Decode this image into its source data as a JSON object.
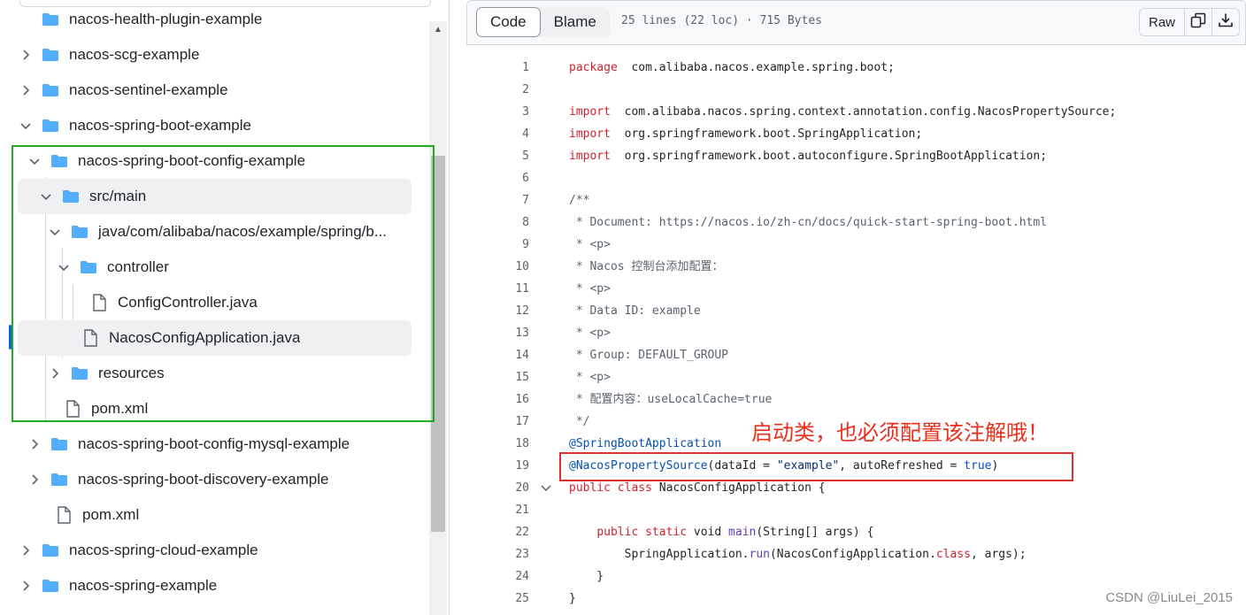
{
  "tree": {
    "rows": [
      {
        "label": "nacos-health-plugin-example",
        "type": "folder",
        "expanded": false
      },
      {
        "label": "nacos-scg-example",
        "type": "folder",
        "expanded": false
      },
      {
        "label": "nacos-sentinel-example",
        "type": "folder",
        "expanded": false
      },
      {
        "label": "nacos-spring-boot-example",
        "type": "folder",
        "expanded": true
      },
      {
        "label": "nacos-spring-boot-config-example",
        "type": "folder",
        "expanded": true
      },
      {
        "label": "src/main",
        "type": "folder",
        "expanded": true
      },
      {
        "label": "java/com/alibaba/nacos/example/spring/b...",
        "type": "folder",
        "expanded": true
      },
      {
        "label": "controller",
        "type": "folder",
        "expanded": true
      },
      {
        "label": "ConfigController.java",
        "type": "file"
      },
      {
        "label": "NacosConfigApplication.java",
        "type": "file"
      },
      {
        "label": "resources",
        "type": "folder",
        "expanded": false
      },
      {
        "label": "pom.xml",
        "type": "file"
      },
      {
        "label": "nacos-spring-boot-config-mysql-example",
        "type": "folder",
        "expanded": false
      },
      {
        "label": "nacos-spring-boot-discovery-example",
        "type": "folder",
        "expanded": false
      },
      {
        "label": "pom.xml",
        "type": "file"
      },
      {
        "label": "nacos-spring-cloud-example",
        "type": "folder",
        "expanded": false
      },
      {
        "label": "nacos-spring-example",
        "type": "folder",
        "expanded": false
      }
    ],
    "selected_file": "NacosConfigApplication.java"
  },
  "viewer": {
    "tabs": [
      "Code",
      "Blame"
    ],
    "active_tab": "Code",
    "file_meta": "25 lines (22 loc) · 715 Bytes",
    "raw_label": "Raw",
    "copy_icon": "copy-icon",
    "download_icon": "download-icon"
  },
  "code": {
    "line_numbers": [
      "1",
      "2",
      "3",
      "4",
      "5",
      "6",
      "7",
      "8",
      "9",
      "10",
      "11",
      "12",
      "13",
      "14",
      "15",
      "16",
      "17",
      "18",
      "19",
      "20",
      "21",
      "22",
      "23",
      "24",
      "25"
    ],
    "lines": [
      [
        [
          "kw",
          "package"
        ],
        [
          "",
          "  com.alibaba.nacos.example.spring.boot;"
        ]
      ],
      [],
      [
        [
          "kw",
          "import"
        ],
        [
          "",
          "  com.alibaba.nacos.spring.context.annotation.config.NacosPropertySource;"
        ]
      ],
      [
        [
          "kw",
          "import"
        ],
        [
          "",
          "  org.springframework.boot.SpringApplication;"
        ]
      ],
      [
        [
          "kw",
          "import"
        ],
        [
          "",
          "  org.springframework.boot.autoconfigure.SpringBootApplication;"
        ]
      ],
      [],
      [
        [
          "cm",
          "/**"
        ]
      ],
      [
        [
          "cm",
          " * Document: https://nacos.io/zh-cn/docs/quick-start-spring-boot.html"
        ]
      ],
      [
        [
          "cm",
          " * <p>"
        ]
      ],
      [
        [
          "cm",
          " * Nacos 控制台添加配置："
        ]
      ],
      [
        [
          "cm",
          " * <p>"
        ]
      ],
      [
        [
          "cm",
          " * Data ID: example"
        ]
      ],
      [
        [
          "cm",
          " * <p>"
        ]
      ],
      [
        [
          "cm",
          " * Group: DEFAULT_GROUP"
        ]
      ],
      [
        [
          "cm",
          " * <p>"
        ]
      ],
      [
        [
          "cm",
          " * 配置内容：useLocalCache=true"
        ]
      ],
      [
        [
          "cm",
          " */"
        ]
      ],
      [
        [
          "an",
          "@SpringBootApplication"
        ]
      ],
      [
        [
          "an",
          "@NacosPropertySource"
        ],
        [
          "",
          "(dataId = "
        ],
        [
          "st",
          "\"example\""
        ],
        [
          "",
          ", autoRefreshed = "
        ],
        [
          "an",
          "true"
        ],
        [
          "",
          ")"
        ]
      ],
      [
        [
          "kw",
          "public"
        ],
        [
          "",
          " "
        ],
        [
          "kw",
          "class"
        ],
        [
          "",
          " NacosConfigApplication {"
        ]
      ],
      [],
      [
        [
          "",
          "    "
        ],
        [
          "kw",
          "public"
        ],
        [
          "",
          " "
        ],
        [
          "kw",
          "static"
        ],
        [
          "",
          " void "
        ],
        [
          "fn",
          "main"
        ],
        [
          "",
          "(String[] args) {"
        ]
      ],
      [
        [
          "",
          "        SpringApplication."
        ],
        [
          "fn",
          "run"
        ],
        [
          "",
          "(NacosConfigApplication."
        ],
        [
          "kw",
          "class"
        ],
        [
          "",
          ", args);"
        ]
      ],
      [
        [
          "",
          "    }"
        ]
      ],
      [
        [
          "",
          "}"
        ]
      ]
    ],
    "fold_line": "20"
  },
  "annotation": {
    "note": "启动类，也必须配置该注解哦！",
    "color": "#e8301c"
  },
  "watermark": "CSDN @LiuLei_2015",
  "colors": {
    "folder": "#54aeff",
    "highlight_green": "#22aa22",
    "highlight_red": "#e03131",
    "keyword": "#cf222e",
    "annotation": "#0550ae"
  }
}
